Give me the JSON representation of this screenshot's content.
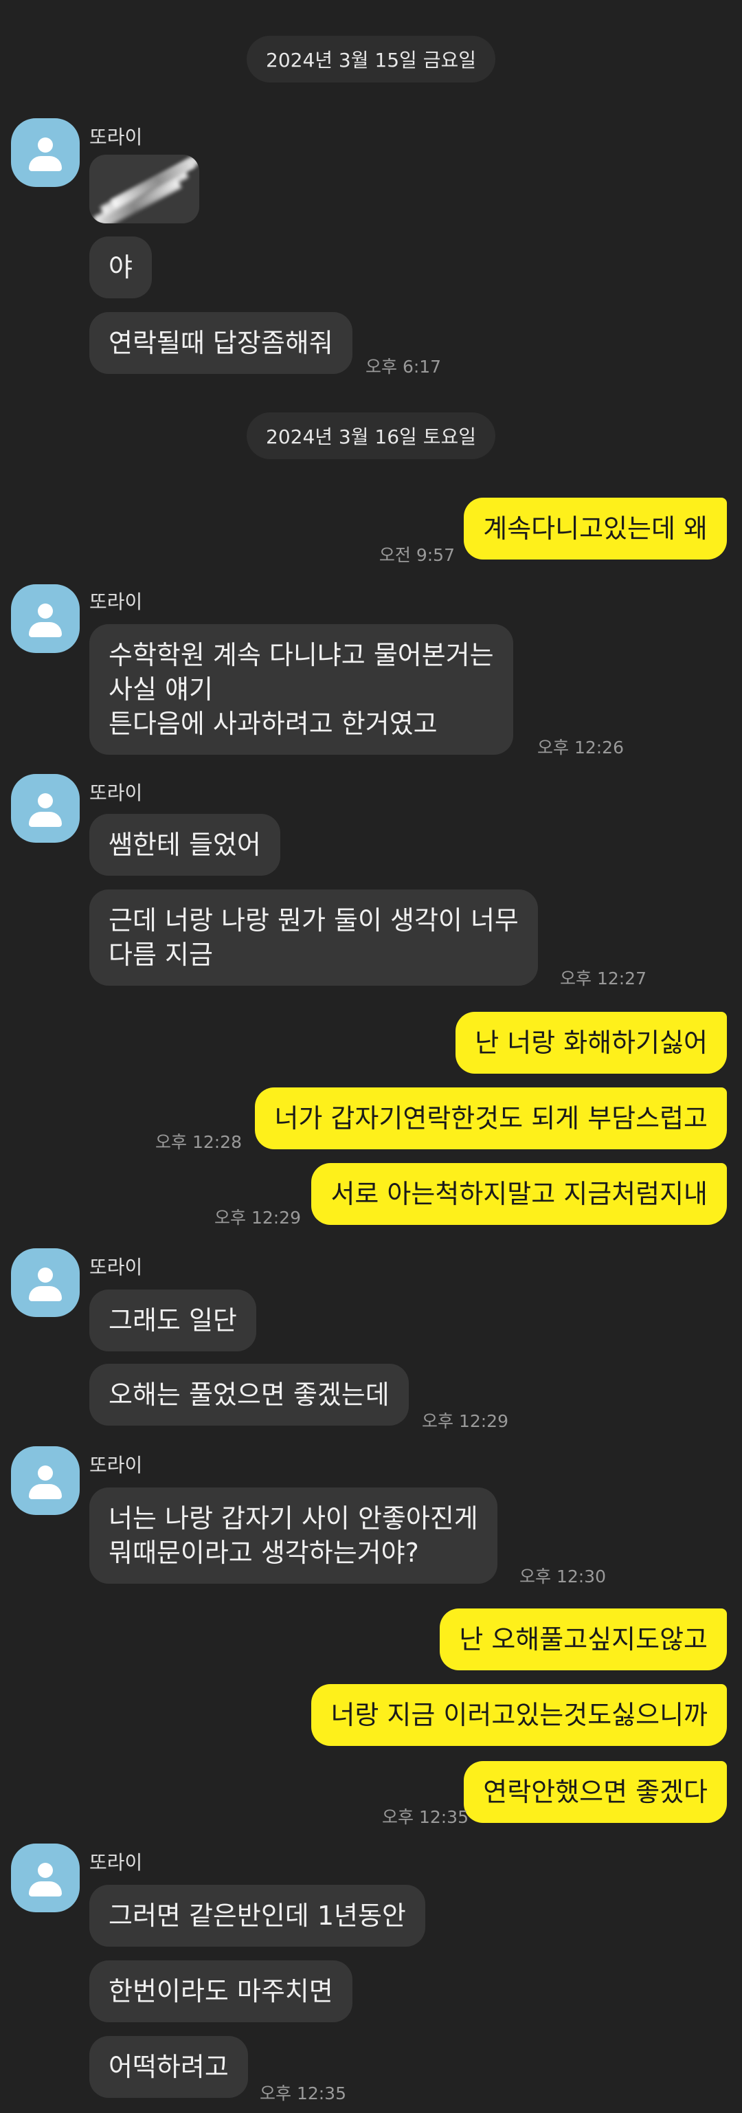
{
  "dates": [
    "2024년 3월 15일 금요일",
    "2024년 3월 16일 토요일"
  ],
  "sender_name": "또라이",
  "messages": {
    "m1": "야",
    "m2": "연락될때 답장좀해줘",
    "t2": "오후 6:17",
    "m3": "계속다니고있는데 왜",
    "t3": "오전 9:57",
    "m4": [
      "수학학원 계속 다니냐고 물어본거는",
      "사실 얘기",
      "튼다음에 사과하려고 한거였고"
    ],
    "t4": "오후 12:26",
    "m5": "쌤한테 들었어",
    "m6": [
      "근데 너랑 나랑 뭔가 둘이 생각이 너무",
      "다름 지금"
    ],
    "t6": "오후 12:27",
    "m7": "난 너랑 화해하기싫어",
    "m8": "너가 갑자기연락한것도 되게 부담스럽고",
    "t8": "오후 12:28",
    "m9": "서로 아는척하지말고 지금처럼지내",
    "t9": "오후 12:29",
    "m10": "그래도 일단",
    "m11": "오해는 풀었으면 좋겠는데",
    "t11": "오후 12:29",
    "m12": [
      "너는 나랑 갑자기 사이 안좋아진게",
      "뭐때문이라고 생각하는거야?"
    ],
    "t12": "오후 12:30",
    "m13": "난 오해풀고싶지도않고",
    "m14": "너랑 지금 이러고있는것도싫으니까",
    "m15": "연락안했으면 좋겠다",
    "t15": "오후 12:35",
    "m16": "그러면 같은반인데 1년동안",
    "m17": "한번이라도 마주치면",
    "m18": "어떡하려고",
    "t18": "오후 12:35"
  },
  "icons": {
    "avatar": "default-profile-icon"
  },
  "colors": {
    "background": "#222222",
    "incoming": "#373737",
    "outgoing": "#fef01b",
    "avatar": "#86c3df"
  }
}
